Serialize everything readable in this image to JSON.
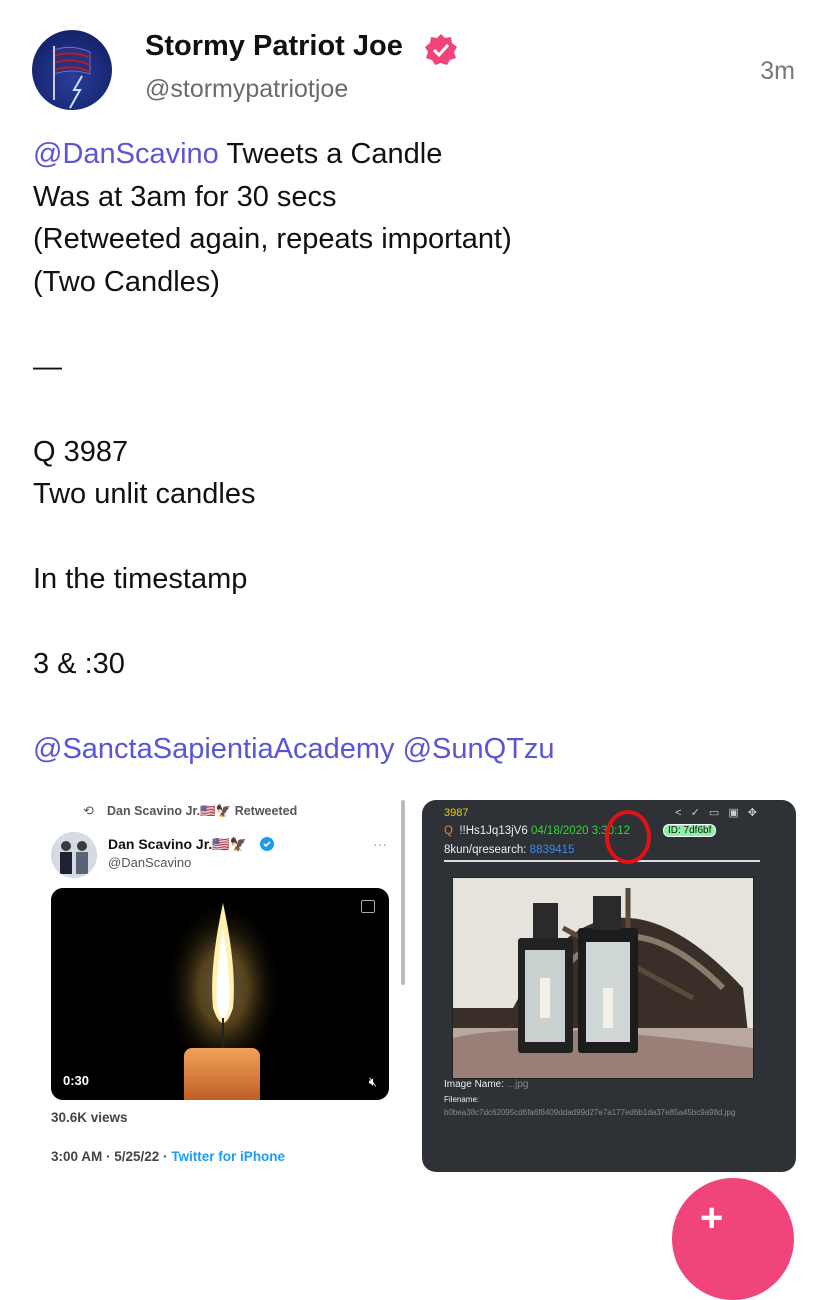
{
  "post": {
    "display_name": "Stormy Patriot Joe",
    "handle": "@stormypatriotjoe",
    "time": "3m",
    "verified_color": "#f0457a",
    "text_lines": [
      {
        "mention": "@DanScavino",
        "text": " Tweets a Candle"
      },
      {
        "mention": "",
        "text": "Was at 3am for 30 secs"
      },
      {
        "mention": "",
        "text": "(Retweeted again, repeats important)"
      },
      {
        "mention": "",
        "text": "(Two Candles)"
      },
      {
        "mention": "",
        "text": ""
      },
      {
        "mention": "",
        "text": "—"
      },
      {
        "mention": "",
        "text": ""
      },
      {
        "mention": "",
        "text": "Q 3987"
      },
      {
        "mention": "",
        "text": "Two unlit candles"
      },
      {
        "mention": "",
        "text": ""
      },
      {
        "mention": "",
        "text": "In the timestamp"
      },
      {
        "mention": "",
        "text": ""
      },
      {
        "mention": "",
        "text": "3 & :30"
      },
      {
        "mention": "",
        "text": ""
      },
      {
        "mention": "@SanctaSapientiaAcademy @SunQTzu",
        "text": ""
      }
    ],
    "mention_color": "#5b55d6"
  },
  "tweet_screenshot": {
    "retweet_label": "Dan Scavino Jr.🇺🇸🦅 Retweeted",
    "name": "Dan Scavino Jr.🇺🇸🦅",
    "handle": "@DanScavino",
    "more": "···",
    "video_duration": "0:30",
    "views": "30.6K views",
    "date": "3:00 AM · 5/25/22 · ",
    "client": "Twitter for iPhone"
  },
  "qpost_screenshot": {
    "number": "3987",
    "icons": "< ✓ ▭ ▣ ✥",
    "letter": "Q",
    "trip": "  !!Hs1Jq13jV6 ",
    "date": "04/18/2020 ",
    "time": "3:30:12",
    "id_badge": "ID: 7df6bf",
    "board": "8kun/qresearch: ",
    "post_link": "8839415",
    "image_name_label": "Image Name: ",
    "image_name_value": "...jpg",
    "filename_label": "Filename:",
    "filename_hash": "b0bea38c7dc62095cd6fa6f8409ddad99d27e7a177ed6b1da37e85a45bc9a98d.jpg"
  }
}
